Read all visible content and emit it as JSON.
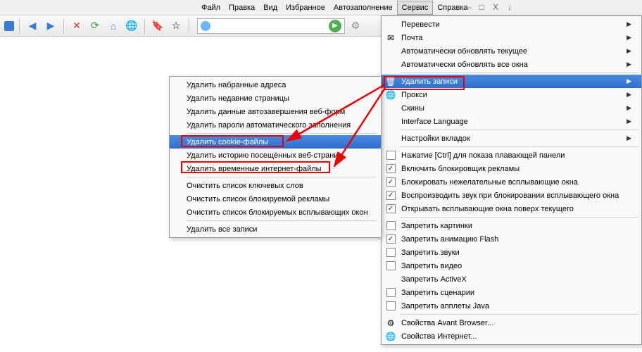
{
  "menubar": {
    "items": [
      "Файл",
      "Правка",
      "Вид",
      "Избранное",
      "Автозаполнение",
      "Сервис",
      "Справка"
    ],
    "active_index": 5
  },
  "window_controls": [
    "—",
    "□",
    "X",
    "↓"
  ],
  "toolbar": {
    "back_icon": "◀",
    "forward_icon": "▶",
    "stop_icon": "✕",
    "refresh_icon": "⟳",
    "home_icon": "⌂",
    "globe_icon": "🌐",
    "tag_icon": "🔖",
    "star_icon": "☆",
    "addr_value": "",
    "go_icon": "▶",
    "extra_icon": "⚙"
  },
  "service_menu": {
    "items": [
      {
        "label": "Перевести",
        "icon": "",
        "type": "submenu"
      },
      {
        "label": "Почта",
        "icon": "✉",
        "type": "submenu"
      },
      {
        "label": "Автоматически обновлять текущее",
        "type": "submenu"
      },
      {
        "label": "Автоматически обновлять все окна",
        "type": "submenu"
      },
      {
        "divider": true
      },
      {
        "label": "Удалить записи",
        "icon": "🗑",
        "type": "submenu",
        "highlight": true
      },
      {
        "label": "Прокси",
        "icon": "🌐",
        "type": "submenu"
      },
      {
        "label": "Скины",
        "type": "submenu"
      },
      {
        "label": "Interface Language",
        "type": "submenu"
      },
      {
        "divider": true
      },
      {
        "label": "Настройки вкладок",
        "type": "submenu"
      },
      {
        "divider": true
      },
      {
        "label": "Нажатие [Ctrl] для показа плавающей панели",
        "type": "check",
        "checked": false
      },
      {
        "label": "Включить блокировщик рекламы",
        "type": "check",
        "checked": true
      },
      {
        "label": "Блокировать нежелательные всплывающие окна",
        "type": "check",
        "checked": true
      },
      {
        "label": "Воспроизводить звук при блокировании всплывающего окна",
        "type": "check",
        "checked": true
      },
      {
        "label": "Открывать всплывающие окна поверх текущего",
        "type": "check",
        "checked": true
      },
      {
        "divider": true
      },
      {
        "label": "Запретить картинки",
        "type": "check",
        "checked": false
      },
      {
        "label": "Запретить анимацию Flash",
        "type": "check",
        "checked": true
      },
      {
        "label": "Запретить звуки",
        "type": "check",
        "checked": false
      },
      {
        "label": "Запретить видео",
        "type": "check",
        "checked": false
      },
      {
        "label": "Запретить ActiveX",
        "type": "item"
      },
      {
        "label": "Запретить сценарии",
        "type": "check",
        "checked": false
      },
      {
        "label": "Запретить апплеты Java",
        "type": "check",
        "checked": false
      },
      {
        "divider": true
      },
      {
        "label": "Свойства Avant Browser...",
        "icon": "⚙",
        "type": "item"
      },
      {
        "label": "Свойства Интернет...",
        "icon": "🌐",
        "type": "item"
      }
    ]
  },
  "delete_submenu": {
    "items": [
      {
        "label": "Удалить набранные адреса"
      },
      {
        "label": "Удалить недавние страницы"
      },
      {
        "label": "Удалить данные автозавершения веб-форм"
      },
      {
        "label": "Удалить пароли автоматического заполнения"
      },
      {
        "divider": true
      },
      {
        "label": "Удалить cookie-файлы",
        "highlight": true
      },
      {
        "label": "Удалить историю посещённых веб-страниц"
      },
      {
        "label": "Удалить временные интернет-файлы"
      },
      {
        "divider": true
      },
      {
        "label": "Очистить список ключевых слов"
      },
      {
        "label": "Очистить список блокируемой рекламы"
      },
      {
        "label": "Очистить список блокируемых всплывающих окон"
      },
      {
        "divider": true
      },
      {
        "label": "Удалить все записи"
      }
    ]
  },
  "annotations": {
    "box_service_item": [
      545,
      108,
      115,
      20
    ],
    "box_cookie_item": [
      257,
      192,
      146,
      17
    ],
    "box_temp_item": [
      257,
      229,
      212,
      17
    ]
  }
}
